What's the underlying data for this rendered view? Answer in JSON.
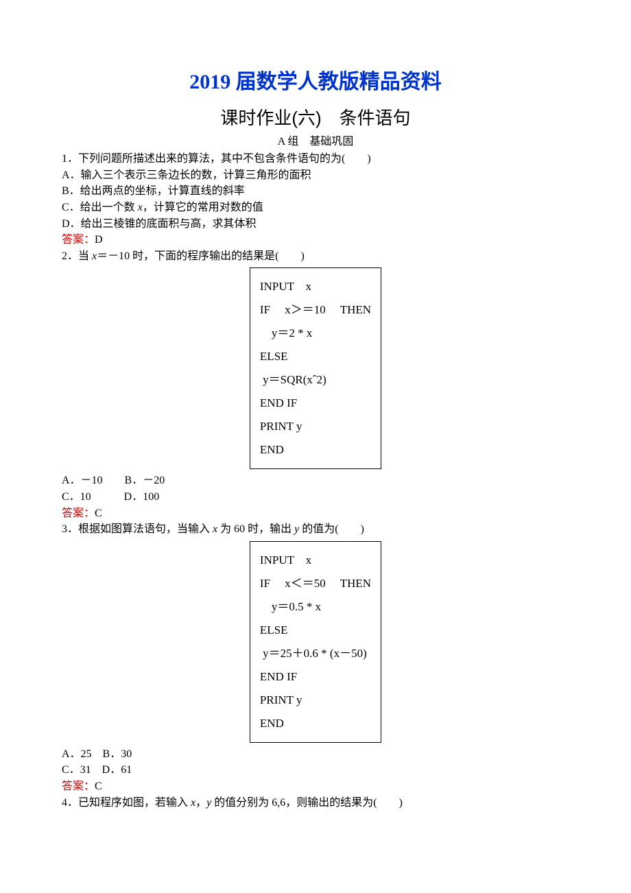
{
  "header": {
    "main_title": "2019 届数学人教版精品资料",
    "sub_title": "课时作业(六)　条件语句",
    "group_label": "A 组　基础巩固"
  },
  "q1": {
    "stem": "1．下列问题所描述出来的算法，其中不包含条件语句的为(　　)",
    "a": "A．输入三个表示三条边长的数，计算三角形的面积",
    "b": "B．给出两点的坐标，计算直线的斜率",
    "c_pre": "C．给出一个数 ",
    "c_var": "x",
    "c_post": "，计算它的常用对数的值",
    "d": "D．给出三棱锥的底面积与高，求其体积",
    "ans_label": "答案：",
    "ans": "D"
  },
  "q2": {
    "stem_pre": "2．当 ",
    "stem_var": "x",
    "stem_post": "＝－10 时，下面的程序输出的结果是(　　)",
    "code": {
      "l1": "INPUT　x",
      "l2": "IF　 x＞＝10　 THEN",
      "l3": "　y＝2 * x",
      "l4": "ELSE",
      "l5": " y＝SQR(xˆ2)",
      "l6": "END IF",
      "l7": "PRINT y",
      "l8": "END"
    },
    "opts_row1": "A．－10　　B．－20",
    "opts_row2": "C．10　　　D．100",
    "ans_label": "答案：",
    "ans": "C"
  },
  "q3": {
    "stem_pre": "3．根据如图算法语句，当输入 ",
    "stem_var1": "x",
    "stem_mid": " 为 60 时，输出 ",
    "stem_var2": "y",
    "stem_post": " 的值为(　　)",
    "code": {
      "l1": "INPUT　x",
      "l2": "IF　 x＜＝50　 THEN",
      "l3": "　y＝0.5 * x",
      "l4": "ELSE",
      "l5": " y＝25＋0.6 * (x－50)",
      "l6": "END IF",
      "l7": "PRINT y",
      "l8": "END"
    },
    "opts_row1": "A．25　B．30",
    "opts_row2": "C．31　D．61",
    "ans_label": "答案：",
    "ans": "C"
  },
  "q4": {
    "stem_pre": "4．已知程序如图，若输入 ",
    "stem_var1": "x",
    "stem_mid1": "，",
    "stem_var2": "y",
    "stem_post": " 的值分别为 6,6，则输出的结果为(　　)"
  }
}
